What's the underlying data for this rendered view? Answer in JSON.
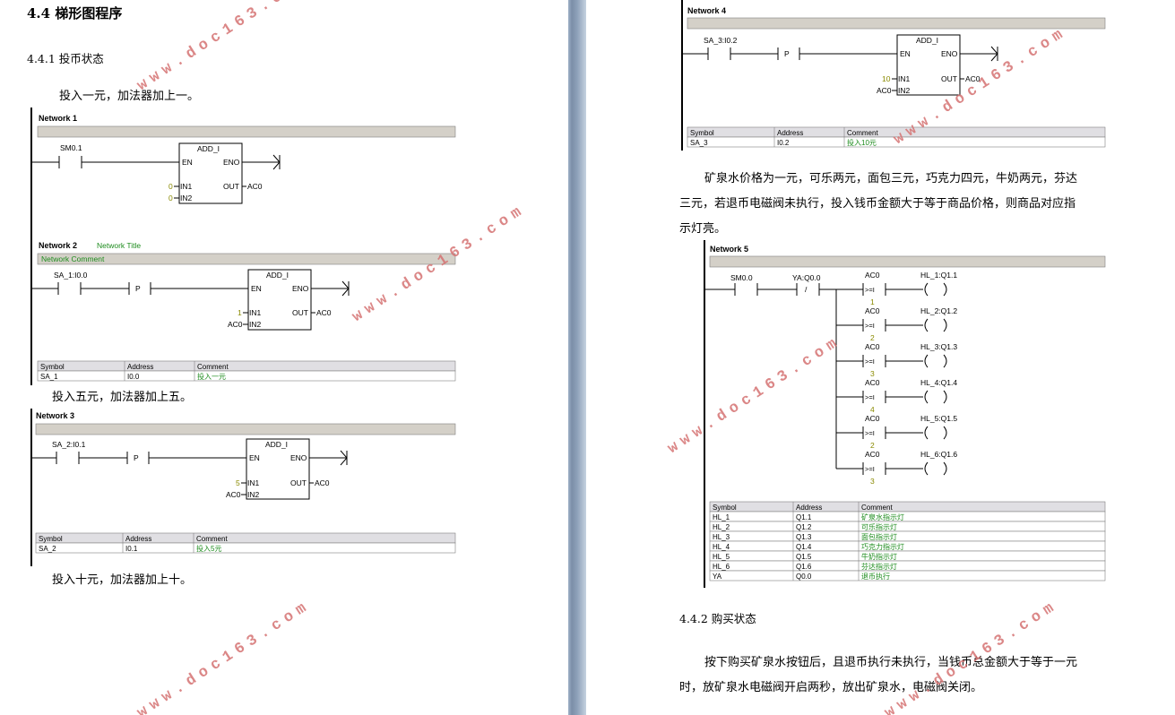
{
  "left_page": {
    "heading": "4.4 梯形图程序",
    "subheading": "4.4.1 投币状态",
    "p1": "投入一元，加法器加上一。",
    "p2": "投入五元，加法器加上五。",
    "p3": "投入十元，加法器加上十。"
  },
  "right_page": {
    "paragraph1": {
      "line1": "矿泉水价格为一元，可乐两元，面包三元，巧克力四元，牛奶两元，芬达",
      "line2": "三元，若退币电磁阀未执行，投入钱币金额大于等于商品价格，则商品对应指",
      "line3": "示灯亮。"
    },
    "subheading2": "4.4.2 购买状态",
    "paragraph2": {
      "line1": "按下购买矿泉水按钮后，且退币执行未执行，当钱币总金额大于等于一元",
      "line2": "时，放矿泉水电磁阀开启两秒，放出矿泉水，电磁阀关闭。"
    }
  },
  "common": {
    "block": "ADD_I",
    "en": "EN",
    "eno": "ENO",
    "in1": "IN1",
    "in2": "IN2",
    "out": "OUT",
    "ac0": "AC0",
    "p": "P",
    "slash": "/",
    "cmp": ">=I",
    "sym_hdr": "Symbol",
    "addr_hdr": "Address",
    "cmt_hdr": "Comment"
  },
  "networks": {
    "n1": {
      "title": "Network 1",
      "contact": "SM0.1",
      "in1": "0",
      "in2": "0"
    },
    "n2": {
      "title": "Network 2",
      "net_title": "Network Title",
      "comment": "Network Comment",
      "contact": "SA_1:I0.0",
      "in1": "1",
      "row": {
        "symbol": "SA_1",
        "address": "I0.0",
        "comment": "投入一元"
      }
    },
    "n3": {
      "title": "Network 3",
      "contact": "SA_2:I0.1",
      "in1": "5",
      "row": {
        "symbol": "SA_2",
        "address": "I0.1",
        "comment": "投入5元"
      }
    },
    "n4": {
      "title": "Network 4",
      "contact": "SA_3:I0.2",
      "in1": "10",
      "row": {
        "symbol": "SA_3",
        "address": "I0.2",
        "comment": "投入10元"
      }
    },
    "n5": {
      "title": "Network 5",
      "contact1": "SM0.0",
      "contact2": "YA:Q0.0",
      "branches": [
        {
          "cmp_top": "AC0",
          "cmp_bot": "1",
          "coil": "HL_1:Q1.1"
        },
        {
          "cmp_top": "AC0",
          "cmp_bot": "2",
          "coil": "HL_2:Q1.2"
        },
        {
          "cmp_top": "AC0",
          "cmp_bot": "3",
          "coil": "HL_3:Q1.3"
        },
        {
          "cmp_top": "AC0",
          "cmp_bot": "4",
          "coil": "HL_4:Q1.4"
        },
        {
          "cmp_top": "AC0",
          "cmp_bot": "2",
          "coil": "HL_5:Q1.5"
        },
        {
          "cmp_top": "AC0",
          "cmp_bot": "3",
          "coil": "HL_6:Q1.6"
        }
      ],
      "rows": [
        {
          "symbol": "HL_1",
          "address": "Q1.1",
          "comment": "矿泉水指示灯"
        },
        {
          "symbol": "HL_2",
          "address": "Q1.2",
          "comment": "可乐指示灯"
        },
        {
          "symbol": "HL_3",
          "address": "Q1.3",
          "comment": "面包指示灯"
        },
        {
          "symbol": "HL_4",
          "address": "Q1.4",
          "comment": "巧克力指示灯"
        },
        {
          "symbol": "HL_5",
          "address": "Q1.5",
          "comment": "牛奶指示灯"
        },
        {
          "symbol": "HL_6",
          "address": "Q1.6",
          "comment": "芬达指示灯"
        },
        {
          "symbol": "YA",
          "address": "Q0.0",
          "comment": "退币执行"
        }
      ]
    }
  },
  "watermark": "www.doc163.com",
  "colors": {
    "watermark": "#d57373",
    "comment_green": "#1e8c1e",
    "const_olive": "#8a8a00",
    "bar_gray": "#d4d0c8"
  }
}
